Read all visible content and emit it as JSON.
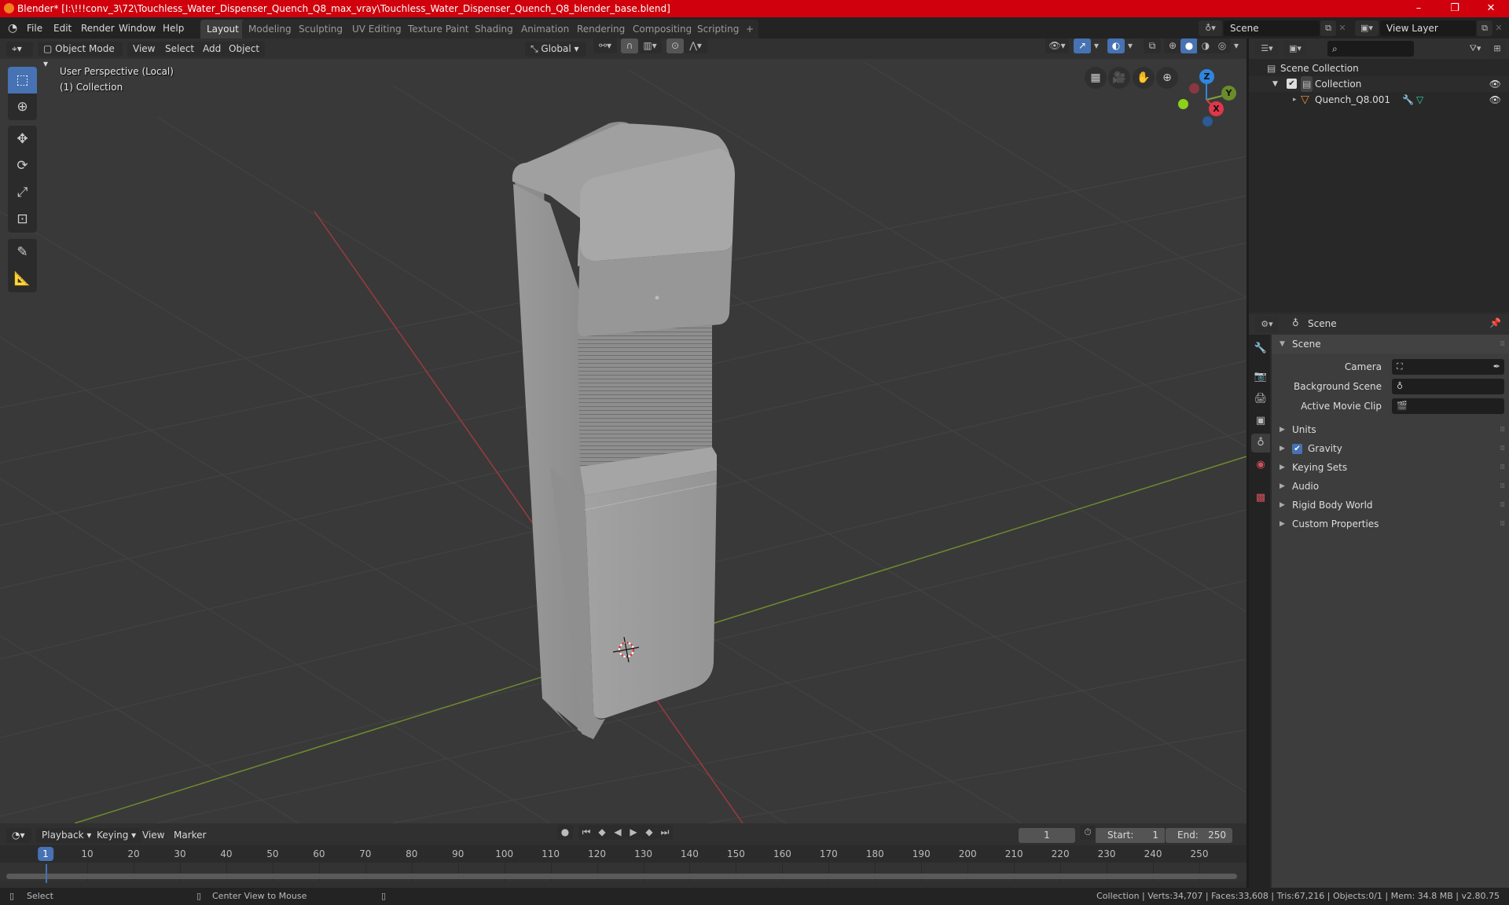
{
  "window": {
    "title": "Blender* [I:\\!!!conv_3\\72\\Touchless_Water_Dispenser_Quench_Q8_max_vray\\Touchless_Water_Dispenser_Quench_Q8_blender_base.blend]",
    "controls": {
      "minimize": "–",
      "maximize": "❐",
      "close": "✕"
    }
  },
  "menubar": {
    "items": [
      "File",
      "Edit",
      "Render",
      "Window",
      "Help"
    ],
    "workspaces": [
      "Layout",
      "Modeling",
      "Sculpting",
      "UV Editing",
      "Texture Paint",
      "Shading",
      "Animation",
      "Rendering",
      "Compositing",
      "Scripting"
    ],
    "active_workspace": "Layout",
    "add_tab": "+",
    "scene_field": "Scene",
    "view_layer_field": "View Layer"
  },
  "viewport": {
    "header": {
      "mode": "Object Mode",
      "menus": [
        "View",
        "Select",
        "Add",
        "Object"
      ],
      "orientation": "Global"
    },
    "info_line1": "User Perspective (Local)",
    "info_line2": "(1) Collection",
    "tools": [
      "select-box",
      "cursor",
      "move",
      "rotate",
      "scale",
      "transform",
      "annotate",
      "measure"
    ],
    "nav_buttons": [
      "grid-icon",
      "camera-icon",
      "hand-icon",
      "zoom-icon"
    ],
    "gizmo": {
      "x": "X",
      "y": "Y",
      "z": "Z"
    },
    "colors": {
      "x_axis": "#c8343f",
      "y_axis": "#7ea33a",
      "z_axis": "#2f86e0",
      "accent": "#4772b3"
    }
  },
  "outliner": {
    "search_placeholder": "",
    "rows": [
      {
        "label": "Scene Collection",
        "level": 0
      },
      {
        "label": "Collection",
        "level": 1,
        "checked": true,
        "visible": true
      },
      {
        "label": "Quench_Q8.001",
        "level": 2,
        "visible": true
      }
    ]
  },
  "properties": {
    "context": "Scene",
    "panel_title": "Scene",
    "fields": [
      {
        "label": "Camera",
        "value": ""
      },
      {
        "label": "Background Scene",
        "value": ""
      },
      {
        "label": "Active Movie Clip",
        "value": ""
      }
    ],
    "subpanels": [
      {
        "label": "Units",
        "checkbox": false
      },
      {
        "label": "Gravity",
        "checkbox": true,
        "checked": true
      },
      {
        "label": "Keying Sets",
        "checkbox": false
      },
      {
        "label": "Audio",
        "checkbox": false
      },
      {
        "label": "Rigid Body World",
        "checkbox": false
      },
      {
        "label": "Custom Properties",
        "checkbox": false
      }
    ]
  },
  "timeline": {
    "menus": [
      "Playback",
      "Keying",
      "View",
      "Marker"
    ],
    "current_frame": "1",
    "start_label": "Start:",
    "start": "1",
    "end_label": "End:",
    "end": "250",
    "ticks": [
      "1",
      "10",
      "20",
      "30",
      "40",
      "50",
      "60",
      "70",
      "80",
      "90",
      "100",
      "110",
      "120",
      "130",
      "140",
      "150",
      "160",
      "170",
      "180",
      "190",
      "200",
      "210",
      "220",
      "230",
      "240",
      "250"
    ]
  },
  "statusbar": {
    "left_action": "Select",
    "middle_action": "Center View to Mouse",
    "stats": "Collection | Verts:34,707 | Faces:33,608 | Tris:67,216 | Objects:0/1 | Mem: 34.8 MB | v2.80.75"
  }
}
